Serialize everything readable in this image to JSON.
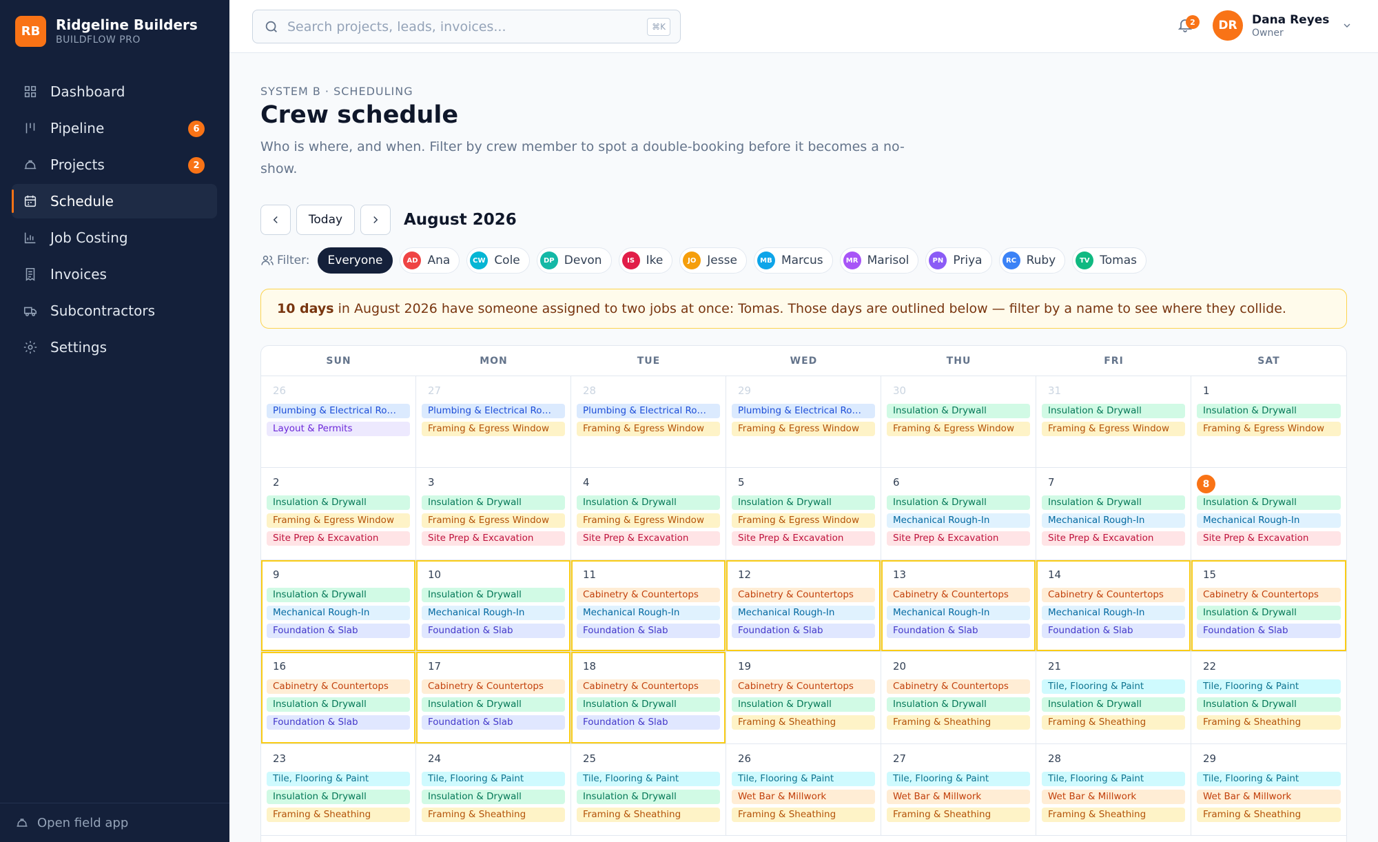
{
  "brand": {
    "initials": "RB",
    "name": "Ridgeline Builders",
    "product": "BUILDFLOW PRO"
  },
  "sidebar": {
    "items": [
      {
        "label": "Dashboard",
        "icon": "grid-icon"
      },
      {
        "label": "Pipeline",
        "icon": "pipeline-icon",
        "badge": "6"
      },
      {
        "label": "Projects",
        "icon": "hard-hat-icon",
        "badge": "2"
      },
      {
        "label": "Schedule",
        "icon": "calendar-icon",
        "active": true
      },
      {
        "label": "Job Costing",
        "icon": "bar-chart-icon"
      },
      {
        "label": "Invoices",
        "icon": "receipt-icon"
      },
      {
        "label": "Subcontractors",
        "icon": "truck-icon"
      },
      {
        "label": "Settings",
        "icon": "gear-icon"
      }
    ],
    "footer": "Open field app"
  },
  "search": {
    "placeholder": "Search projects, leads, invoices...",
    "shortcut": "⌘K"
  },
  "notifications": {
    "count": "2"
  },
  "user": {
    "initials": "DR",
    "name": "Dana Reyes",
    "role": "Owner"
  },
  "page": {
    "eyebrow": "SYSTEM B · SCHEDULING",
    "title": "Crew schedule",
    "description": "Who is where, and when. Filter by crew member to spot a double-booking before it becomes a no-show."
  },
  "calendar_nav": {
    "today_label": "Today",
    "month": "August 2026"
  },
  "filter": {
    "label": "Filter:",
    "chips": [
      {
        "label": "Everyone",
        "active": true
      },
      {
        "label": "Ana",
        "initials": "AD",
        "color": "#ef4444"
      },
      {
        "label": "Cole",
        "initials": "CW",
        "color": "#06b6d4"
      },
      {
        "label": "Devon",
        "initials": "DP",
        "color": "#14b8a6"
      },
      {
        "label": "Ike",
        "initials": "IS",
        "color": "#e11d48"
      },
      {
        "label": "Jesse",
        "initials": "JO",
        "color": "#f59e0b"
      },
      {
        "label": "Marcus",
        "initials": "MB",
        "color": "#0ea5e9"
      },
      {
        "label": "Marisol",
        "initials": "MR",
        "color": "#a855f7"
      },
      {
        "label": "Priya",
        "initials": "PN",
        "color": "#8b5cf6"
      },
      {
        "label": "Ruby",
        "initials": "RC",
        "color": "#3b82f6"
      },
      {
        "label": "Tomas",
        "initials": "TV",
        "color": "#10b981"
      }
    ]
  },
  "alert": {
    "strong": "10 days",
    "text": "in August 2026 have someone assigned to two jobs at once: Tomas. Those days are outlined below — filter by a name to see where they collide."
  },
  "weekdays": [
    "SUN",
    "MON",
    "TUE",
    "WED",
    "THU",
    "FRI",
    "SAT"
  ],
  "days": [
    {
      "num": "26",
      "muted": true,
      "events": [
        {
          "t": "Plumbing & Electrical Ro…",
          "c": "blue"
        },
        {
          "t": "Layout & Permits",
          "c": "violet"
        }
      ]
    },
    {
      "num": "27",
      "muted": true,
      "events": [
        {
          "t": "Plumbing & Electrical Ro…",
          "c": "blue"
        },
        {
          "t": "Framing & Egress Window",
          "c": "yellow"
        }
      ]
    },
    {
      "num": "28",
      "muted": true,
      "events": [
        {
          "t": "Plumbing & Electrical Ro…",
          "c": "blue"
        },
        {
          "t": "Framing & Egress Window",
          "c": "yellow"
        }
      ]
    },
    {
      "num": "29",
      "muted": true,
      "events": [
        {
          "t": "Plumbing & Electrical Ro…",
          "c": "blue"
        },
        {
          "t": "Framing & Egress Window",
          "c": "yellow"
        }
      ]
    },
    {
      "num": "30",
      "muted": true,
      "events": [
        {
          "t": "Insulation & Drywall",
          "c": "green"
        },
        {
          "t": "Framing & Egress Window",
          "c": "yellow"
        }
      ]
    },
    {
      "num": "31",
      "muted": true,
      "events": [
        {
          "t": "Insulation & Drywall",
          "c": "green"
        },
        {
          "t": "Framing & Egress Window",
          "c": "yellow"
        }
      ]
    },
    {
      "num": "1",
      "events": [
        {
          "t": "Insulation & Drywall",
          "c": "green"
        },
        {
          "t": "Framing & Egress Window",
          "c": "yellow"
        }
      ]
    },
    {
      "num": "2",
      "events": [
        {
          "t": "Insulation & Drywall",
          "c": "green"
        },
        {
          "t": "Framing & Egress Window",
          "c": "yellow"
        },
        {
          "t": "Site Prep & Excavation",
          "c": "red"
        }
      ]
    },
    {
      "num": "3",
      "events": [
        {
          "t": "Insulation & Drywall",
          "c": "green"
        },
        {
          "t": "Framing & Egress Window",
          "c": "yellow"
        },
        {
          "t": "Site Prep & Excavation",
          "c": "red"
        }
      ]
    },
    {
      "num": "4",
      "events": [
        {
          "t": "Insulation & Drywall",
          "c": "green"
        },
        {
          "t": "Framing & Egress Window",
          "c": "yellow"
        },
        {
          "t": "Site Prep & Excavation",
          "c": "red"
        }
      ]
    },
    {
      "num": "5",
      "events": [
        {
          "t": "Insulation & Drywall",
          "c": "green"
        },
        {
          "t": "Framing & Egress Window",
          "c": "yellow"
        },
        {
          "t": "Site Prep & Excavation",
          "c": "red"
        }
      ]
    },
    {
      "num": "6",
      "events": [
        {
          "t": "Insulation & Drywall",
          "c": "green"
        },
        {
          "t": "Mechanical Rough-In",
          "c": "sky"
        },
        {
          "t": "Site Prep & Excavation",
          "c": "red"
        }
      ]
    },
    {
      "num": "7",
      "events": [
        {
          "t": "Insulation & Drywall",
          "c": "green"
        },
        {
          "t": "Mechanical Rough-In",
          "c": "sky"
        },
        {
          "t": "Site Prep & Excavation",
          "c": "red"
        }
      ]
    },
    {
      "num": "8",
      "today": true,
      "events": [
        {
          "t": "Insulation & Drywall",
          "c": "green"
        },
        {
          "t": "Mechanical Rough-In",
          "c": "sky"
        },
        {
          "t": "Site Prep & Excavation",
          "c": "red"
        }
      ]
    },
    {
      "num": "9",
      "conflict": true,
      "events": [
        {
          "t": "Insulation & Drywall",
          "c": "green"
        },
        {
          "t": "Mechanical Rough-In",
          "c": "sky"
        },
        {
          "t": "Foundation & Slab",
          "c": "indigo"
        }
      ]
    },
    {
      "num": "10",
      "conflict": true,
      "events": [
        {
          "t": "Insulation & Drywall",
          "c": "green"
        },
        {
          "t": "Mechanical Rough-In",
          "c": "sky"
        },
        {
          "t": "Foundation & Slab",
          "c": "indigo"
        }
      ]
    },
    {
      "num": "11",
      "conflict": true,
      "events": [
        {
          "t": "Cabinetry & Countertops",
          "c": "orange"
        },
        {
          "t": "Mechanical Rough-In",
          "c": "sky"
        },
        {
          "t": "Foundation & Slab",
          "c": "indigo"
        }
      ]
    },
    {
      "num": "12",
      "conflict": true,
      "events": [
        {
          "t": "Cabinetry & Countertops",
          "c": "orange"
        },
        {
          "t": "Mechanical Rough-In",
          "c": "sky"
        },
        {
          "t": "Foundation & Slab",
          "c": "indigo"
        }
      ]
    },
    {
      "num": "13",
      "conflict": true,
      "events": [
        {
          "t": "Cabinetry & Countertops",
          "c": "orange"
        },
        {
          "t": "Mechanical Rough-In",
          "c": "sky"
        },
        {
          "t": "Foundation & Slab",
          "c": "indigo"
        }
      ]
    },
    {
      "num": "14",
      "conflict": true,
      "events": [
        {
          "t": "Cabinetry & Countertops",
          "c": "orange"
        },
        {
          "t": "Mechanical Rough-In",
          "c": "sky"
        },
        {
          "t": "Foundation & Slab",
          "c": "indigo"
        }
      ]
    },
    {
      "num": "15",
      "conflict": true,
      "events": [
        {
          "t": "Cabinetry & Countertops",
          "c": "orange"
        },
        {
          "t": "Insulation & Drywall",
          "c": "green"
        },
        {
          "t": "Foundation & Slab",
          "c": "indigo"
        }
      ]
    },
    {
      "num": "16",
      "conflict": true,
      "events": [
        {
          "t": "Cabinetry & Countertops",
          "c": "orange"
        },
        {
          "t": "Insulation & Drywall",
          "c": "green"
        },
        {
          "t": "Foundation & Slab",
          "c": "indigo"
        }
      ]
    },
    {
      "num": "17",
      "conflict": true,
      "events": [
        {
          "t": "Cabinetry & Countertops",
          "c": "orange"
        },
        {
          "t": "Insulation & Drywall",
          "c": "green"
        },
        {
          "t": "Foundation & Slab",
          "c": "indigo"
        }
      ]
    },
    {
      "num": "18",
      "conflict": true,
      "events": [
        {
          "t": "Cabinetry & Countertops",
          "c": "orange"
        },
        {
          "t": "Insulation & Drywall",
          "c": "green"
        },
        {
          "t": "Foundation & Slab",
          "c": "indigo"
        }
      ]
    },
    {
      "num": "19",
      "events": [
        {
          "t": "Cabinetry & Countertops",
          "c": "orange"
        },
        {
          "t": "Insulation & Drywall",
          "c": "green"
        },
        {
          "t": "Framing & Sheathing",
          "c": "yellow"
        }
      ]
    },
    {
      "num": "20",
      "events": [
        {
          "t": "Cabinetry & Countertops",
          "c": "orange"
        },
        {
          "t": "Insulation & Drywall",
          "c": "green"
        },
        {
          "t": "Framing & Sheathing",
          "c": "yellow"
        }
      ]
    },
    {
      "num": "21",
      "events": [
        {
          "t": "Tile, Flooring & Paint",
          "c": "cyan"
        },
        {
          "t": "Insulation & Drywall",
          "c": "green"
        },
        {
          "t": "Framing & Sheathing",
          "c": "yellow"
        }
      ]
    },
    {
      "num": "22",
      "events": [
        {
          "t": "Tile, Flooring & Paint",
          "c": "cyan"
        },
        {
          "t": "Insulation & Drywall",
          "c": "green"
        },
        {
          "t": "Framing & Sheathing",
          "c": "yellow"
        }
      ]
    },
    {
      "num": "23",
      "events": [
        {
          "t": "Tile, Flooring & Paint",
          "c": "cyan"
        },
        {
          "t": "Insulation & Drywall",
          "c": "green"
        },
        {
          "t": "Framing & Sheathing",
          "c": "yellow"
        }
      ]
    },
    {
      "num": "24",
      "events": [
        {
          "t": "Tile, Flooring & Paint",
          "c": "cyan"
        },
        {
          "t": "Insulation & Drywall",
          "c": "green"
        },
        {
          "t": "Framing & Sheathing",
          "c": "yellow"
        }
      ]
    },
    {
      "num": "25",
      "events": [
        {
          "t": "Tile, Flooring & Paint",
          "c": "cyan"
        },
        {
          "t": "Insulation & Drywall",
          "c": "green"
        },
        {
          "t": "Framing & Sheathing",
          "c": "yellow"
        }
      ]
    },
    {
      "num": "26",
      "events": [
        {
          "t": "Tile, Flooring & Paint",
          "c": "cyan"
        },
        {
          "t": "Wet Bar & Millwork",
          "c": "orange"
        },
        {
          "t": "Framing & Sheathing",
          "c": "yellow"
        }
      ]
    },
    {
      "num": "27",
      "events": [
        {
          "t": "Tile, Flooring & Paint",
          "c": "cyan"
        },
        {
          "t": "Wet Bar & Millwork",
          "c": "orange"
        },
        {
          "t": "Framing & Sheathing",
          "c": "yellow"
        }
      ]
    },
    {
      "num": "28",
      "events": [
        {
          "t": "Tile, Flooring & Paint",
          "c": "cyan"
        },
        {
          "t": "Wet Bar & Millwork",
          "c": "orange"
        },
        {
          "t": "Framing & Sheathing",
          "c": "yellow"
        }
      ]
    },
    {
      "num": "29",
      "events": [
        {
          "t": "Tile, Flooring & Paint",
          "c": "cyan"
        },
        {
          "t": "Wet Bar & Millwork",
          "c": "orange"
        },
        {
          "t": "Framing & Sheathing",
          "c": "yellow"
        }
      ]
    }
  ]
}
